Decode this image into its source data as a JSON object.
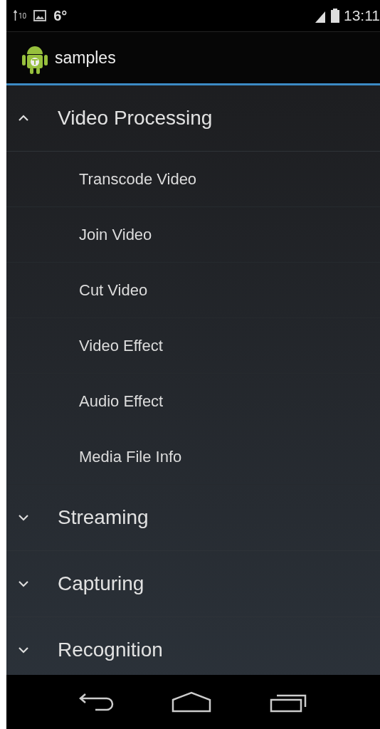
{
  "status_bar": {
    "upload_speed": "10",
    "temperature": "6°",
    "time": "13:11"
  },
  "action_bar": {
    "title": "samples"
  },
  "groups": [
    {
      "label": "Video Processing",
      "expanded": true,
      "children": [
        {
          "label": "Transcode Video"
        },
        {
          "label": "Join Video"
        },
        {
          "label": "Cut Video"
        },
        {
          "label": "Video Effect"
        },
        {
          "label": "Audio Effect"
        },
        {
          "label": "Media File Info"
        }
      ]
    },
    {
      "label": "Streaming",
      "expanded": false
    },
    {
      "label": "Capturing",
      "expanded": false
    },
    {
      "label": "Recognition",
      "expanded": false
    }
  ]
}
